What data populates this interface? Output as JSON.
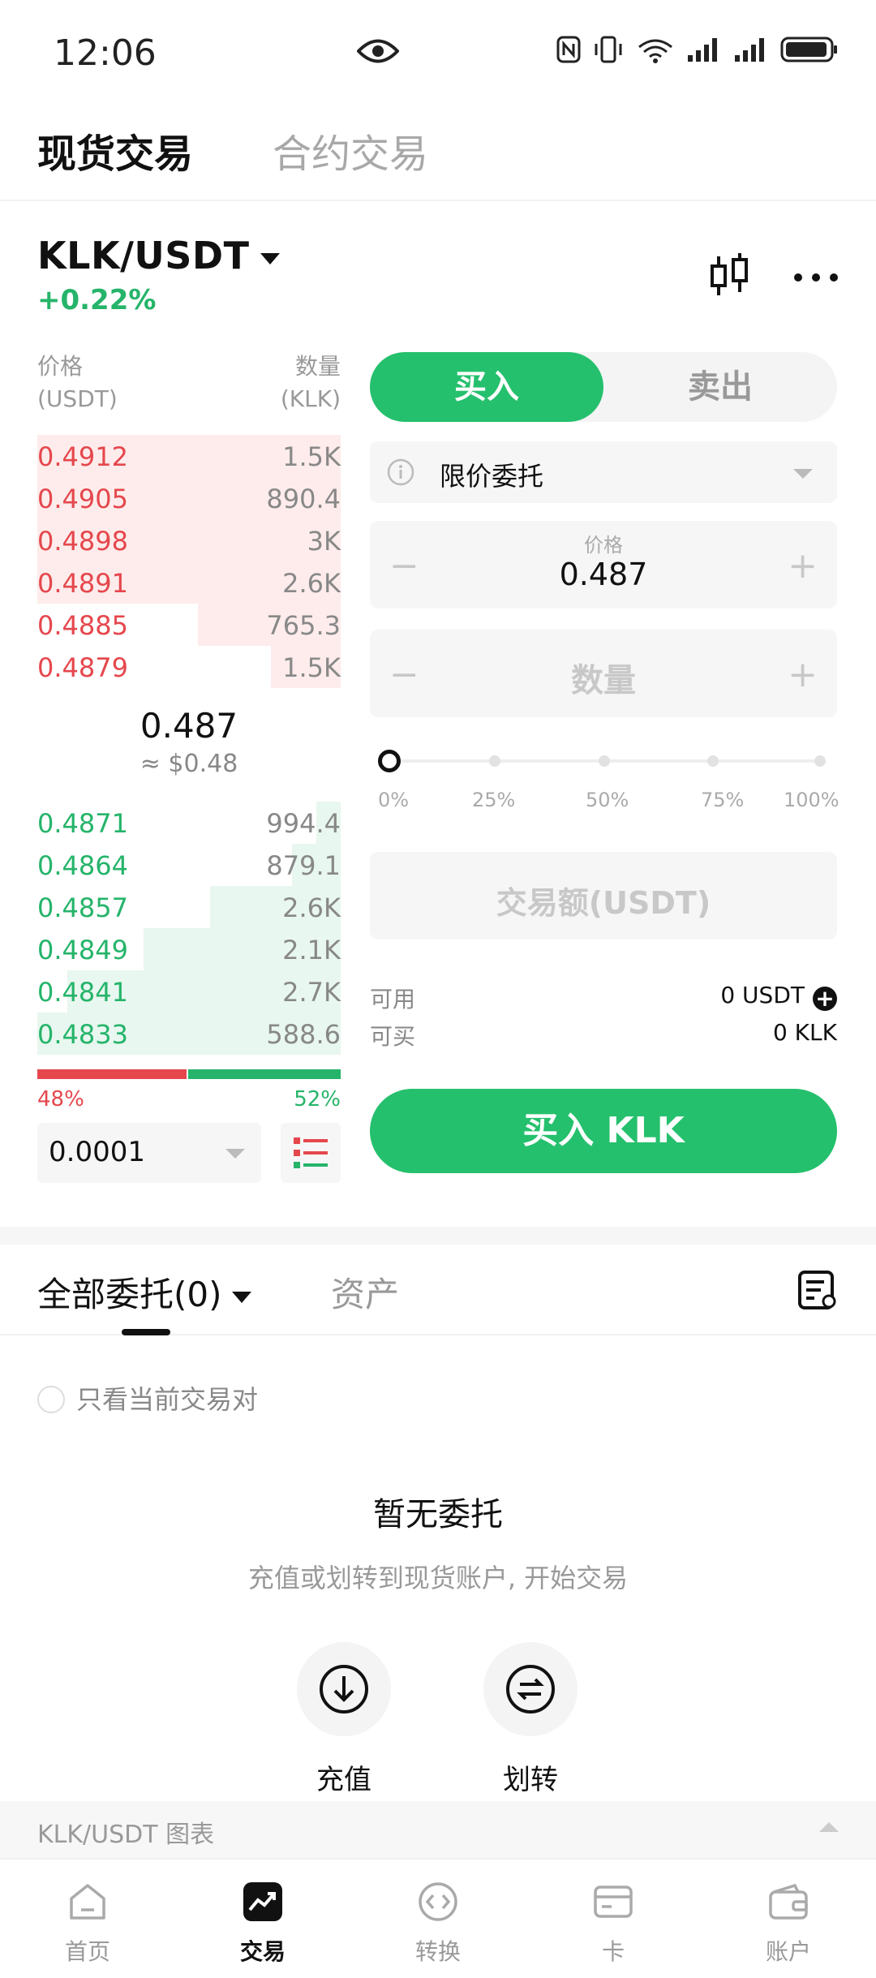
{
  "status_bar": {
    "time": "12:06"
  },
  "top_tabs": {
    "spot": "现货交易",
    "futures": "合约交易"
  },
  "pair": {
    "symbol": "KLK/USDT",
    "change": "+0.22%"
  },
  "orderbook": {
    "price_header": "价格",
    "price_unit": "(USDT)",
    "qty_header": "数量",
    "qty_unit": "(KLK)",
    "asks": [
      {
        "price": "0.4912",
        "qty": "1.5K",
        "depth": 1.0
      },
      {
        "price": "0.4905",
        "qty": "890.4",
        "depth": 1.0
      },
      {
        "price": "0.4898",
        "qty": "3K",
        "depth": 1.0
      },
      {
        "price": "0.4891",
        "qty": "2.6K",
        "depth": 1.0
      },
      {
        "price": "0.4885",
        "qty": "765.3",
        "depth": 0.47
      },
      {
        "price": "0.4879",
        "qty": "1.5K",
        "depth": 0.23
      }
    ],
    "last_price": "0.487",
    "last_price_usd": "≈ $0.48",
    "bids": [
      {
        "price": "0.4871",
        "qty": "994.4",
        "depth": 0.08
      },
      {
        "price": "0.4864",
        "qty": "879.1",
        "depth": 0.16
      },
      {
        "price": "0.4857",
        "qty": "2.6K",
        "depth": 0.43
      },
      {
        "price": "0.4849",
        "qty": "2.1K",
        "depth": 0.65
      },
      {
        "price": "0.4841",
        "qty": "2.7K",
        "depth": 0.9
      },
      {
        "price": "0.4833",
        "qty": "588.6",
        "depth": 1.0
      }
    ],
    "buy_ratio": "48%",
    "sell_ratio": "52%",
    "precision": "0.0001"
  },
  "trade": {
    "buy_tab": "买入",
    "sell_tab": "卖出",
    "order_type": "限价委托",
    "price_label": "价格",
    "price_value": "0.487",
    "qty_placeholder": "数量",
    "slider_value": 0,
    "slider_marks": [
      "0%",
      "25%",
      "50%",
      "75%",
      "100%"
    ],
    "amount_placeholder": "交易额(USDT)",
    "available_label": "可用",
    "available_value": "0 USDT",
    "buyable_label": "可买",
    "buyable_value": "0 KLK",
    "submit": "买入 KLK"
  },
  "orders": {
    "all_tab": "全部委托(0)",
    "assets_tab": "资产",
    "filter_label": "只看当前交易对",
    "empty_title": "暂无委托",
    "empty_subtitle": "充值或划转到现货账户, 开始交易",
    "deposit": "充值",
    "transfer": "划转"
  },
  "chart_bar": {
    "label": "KLK/USDT 图表"
  },
  "bottom_nav": {
    "home": "首页",
    "trade": "交易",
    "convert": "转换",
    "card": "卡",
    "account": "账户"
  },
  "colors": {
    "buy": "#25c06d",
    "sell": "#e5474d"
  }
}
